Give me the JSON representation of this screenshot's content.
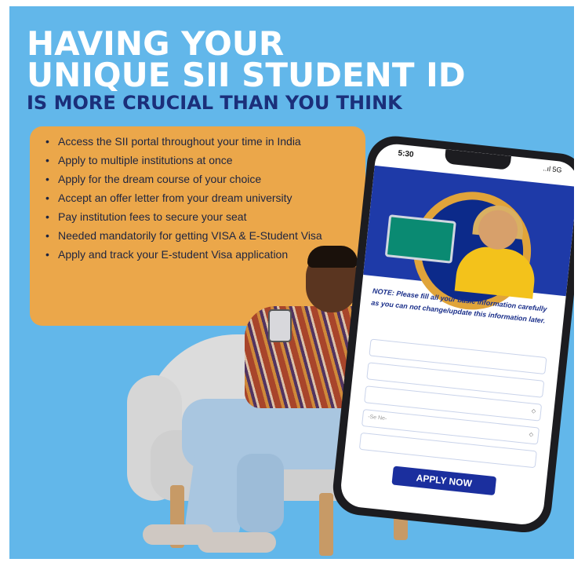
{
  "headline": {
    "line1": "HAVING YOUR",
    "line2": "UNIQUE SII STUDENT ID",
    "subheadline": "IS MORE CRUCIAL THAN YOU THINK"
  },
  "benefits": [
    "Access the SII portal throughout your time in India",
    "Apply to multiple institutions at once",
    "Apply for the dream course of your choice",
    "Accept an offer letter from your dream university",
    "Pay institution fees to secure your seat",
    "Needed mandatorily for getting VISA & E-Student Visa",
    "Apply and track your E-student Visa application"
  ],
  "phone": {
    "time": "5:30",
    "signal": "..ıl 5G",
    "note": "NOTE: Please fill all your basic information carefully as you can not change/update this information later.",
    "field_placeholder": "-Se Ne-",
    "apply_button": "APPLY NOW"
  },
  "colors": {
    "background": "#62b7ea",
    "headline": "#ffffff",
    "subheadline": "#1b2f7a",
    "benefit_box": "#eba74a",
    "button": "#1b2f9e"
  }
}
